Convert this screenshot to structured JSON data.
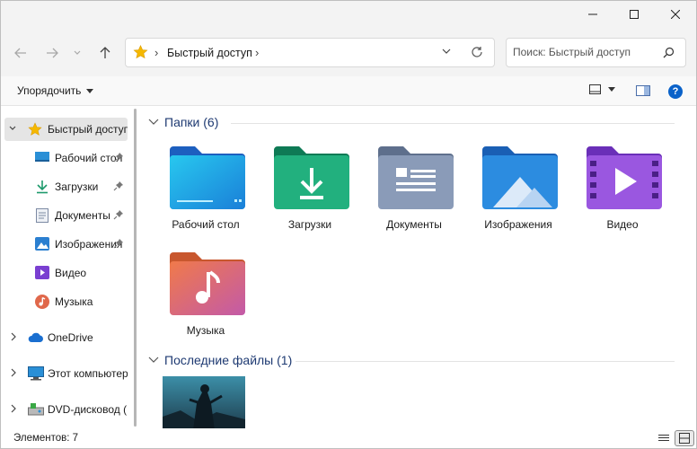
{
  "window": {
    "minimize_icon": "minimize-icon",
    "maximize_icon": "maximize-icon",
    "close_icon": "close-icon"
  },
  "address": {
    "location": "Быстрый доступ",
    "location_icon": "star-icon",
    "separator": "›"
  },
  "search": {
    "placeholder": "Поиск: Быстрый доступ"
  },
  "command_bar": {
    "sort_label": "Упорядочить",
    "help_label": "?"
  },
  "nav": {
    "items": [
      {
        "label": "Быстрый доступ",
        "icon": "star-icon",
        "pinned": false
      },
      {
        "label": "Рабочий стол",
        "icon": "desktop-icon",
        "pinned": true
      },
      {
        "label": "Загрузки",
        "icon": "download-icon",
        "pinned": true
      },
      {
        "label": "Документы",
        "icon": "documents-icon",
        "pinned": true
      },
      {
        "label": "Изображения",
        "icon": "pictures-icon",
        "pinned": true
      },
      {
        "label": "Видео",
        "icon": "video-icon",
        "pinned": false
      },
      {
        "label": "Музыка",
        "icon": "music-icon",
        "pinned": false
      },
      {
        "label": "OneDrive",
        "icon": "cloud-icon",
        "pinned": false
      },
      {
        "label": "Этот компьютер",
        "icon": "computer-icon",
        "pinned": false
      },
      {
        "label": "DVD-дисковод (D:)",
        "icon": "dvd-drive-icon",
        "pinned": false
      }
    ]
  },
  "content": {
    "folders_header": "Папки (6)",
    "folders": [
      {
        "label": "Рабочий стол",
        "icon": "desktop-folder-icon"
      },
      {
        "label": "Загрузки",
        "icon": "downloads-folder-icon"
      },
      {
        "label": "Документы",
        "icon": "documents-folder-icon"
      },
      {
        "label": "Изображения",
        "icon": "pictures-folder-icon"
      },
      {
        "label": "Видео",
        "icon": "video-folder-icon"
      },
      {
        "label": "Музыка",
        "icon": "music-folder-icon"
      }
    ],
    "recent_header": "Последние файлы (1)"
  },
  "status": {
    "items_count": "Элементов: 7"
  },
  "colors": {
    "accent": "#0a62c9",
    "header_text": "#1e3a72",
    "star": "#f5b800"
  }
}
